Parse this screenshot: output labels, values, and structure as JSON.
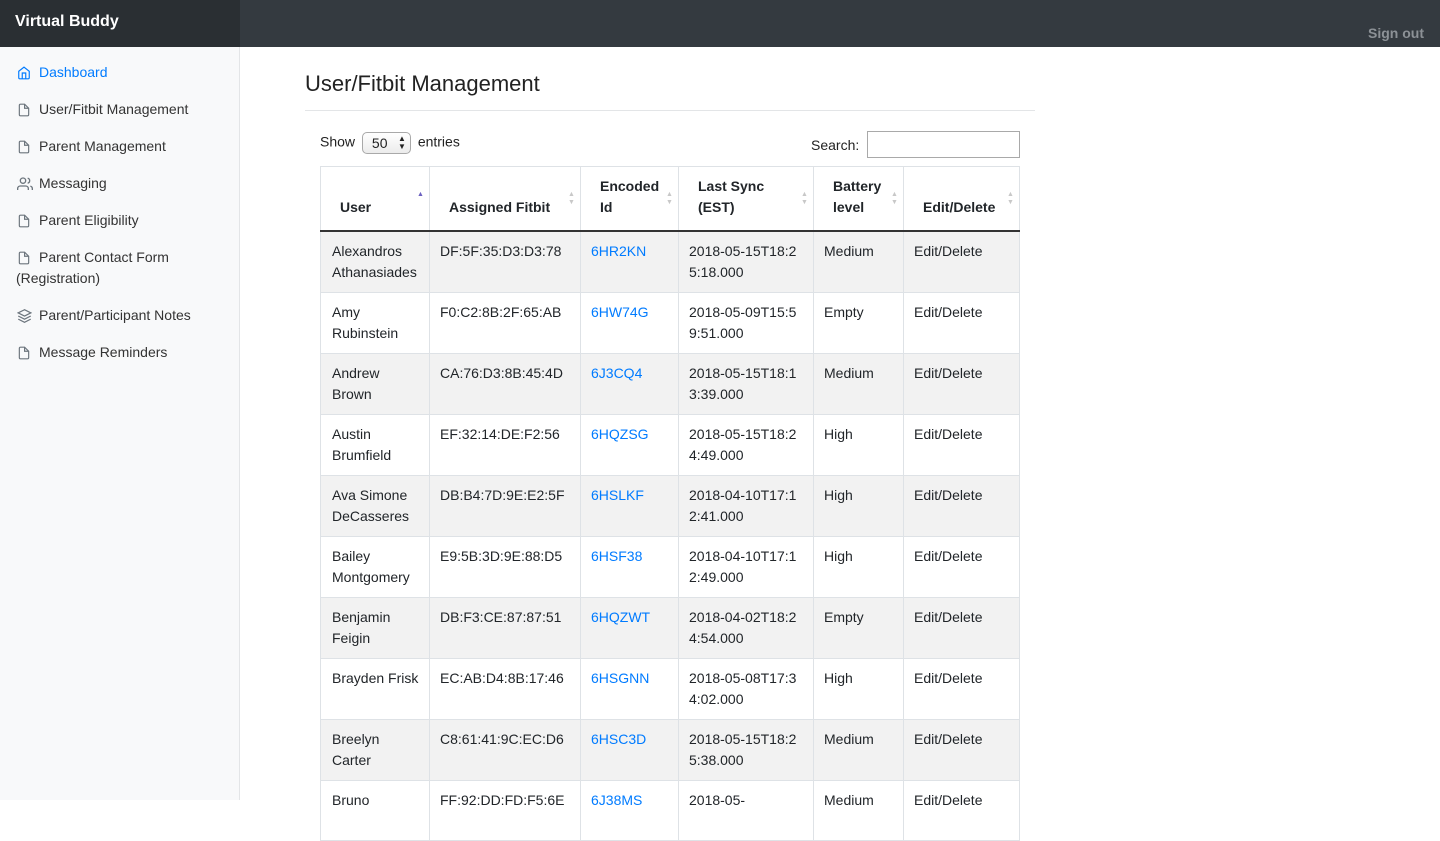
{
  "app": {
    "brand": "Virtual Buddy",
    "signout_label": "Sign out"
  },
  "sidebar": {
    "items": [
      {
        "label": "Dashboard",
        "icon": "home-icon",
        "active": true
      },
      {
        "label": "User/Fitbit Management",
        "icon": "file-icon"
      },
      {
        "label": "Parent Management",
        "icon": "file-icon"
      },
      {
        "label": "Messaging",
        "icon": "users-icon"
      },
      {
        "label": "Parent Eligibility",
        "icon": "file-icon"
      },
      {
        "label": "Parent Contact Form (Registration)",
        "icon": "file-icon"
      },
      {
        "label": "Parent/Participant Notes",
        "icon": "layers-icon"
      },
      {
        "label": "Message Reminders",
        "icon": "file-icon"
      }
    ]
  },
  "main": {
    "title": "User/Fitbit Management",
    "show_label": "Show",
    "entries_label": "entries",
    "page_size": "50",
    "search_label": "Search:",
    "search_value": ""
  },
  "table": {
    "columns": [
      "User",
      "Assigned Fitbit",
      "Encoded Id",
      "Last Sync (EST)",
      "Battery level",
      "Edit/Delete"
    ],
    "sorted_column": "User",
    "rows": [
      {
        "user": "Alexandros Athanasiades",
        "fitbit": "DF:5F:35:D3:D3:78",
        "encoded_id": "6HR2KN",
        "last_sync": "2018-05-15T18:25:18.000",
        "battery": "Medium",
        "action": "Edit/Delete"
      },
      {
        "user": "Amy Rubinstein",
        "fitbit": "F0:C2:8B:2F:65:AB",
        "encoded_id": "6HW74G",
        "last_sync": "2018-05-09T15:59:51.000",
        "battery": "Empty",
        "action": "Edit/Delete"
      },
      {
        "user": "Andrew Brown",
        "fitbit": "CA:76:D3:8B:45:4D",
        "encoded_id": "6J3CQ4",
        "last_sync": "2018-05-15T18:13:39.000",
        "battery": "Medium",
        "action": "Edit/Delete"
      },
      {
        "user": "Austin Brumfield",
        "fitbit": "EF:32:14:DE:F2:56",
        "encoded_id": "6HQZSG",
        "last_sync": "2018-05-15T18:24:49.000",
        "battery": "High",
        "action": "Edit/Delete"
      },
      {
        "user": "Ava Simone DeCasseres",
        "fitbit": "DB:B4:7D:9E:E2:5F",
        "encoded_id": "6HSLKF",
        "last_sync": "2018-04-10T17:12:41.000",
        "battery": "High",
        "action": "Edit/Delete"
      },
      {
        "user": "Bailey Montgomery",
        "fitbit": "E9:5B:3D:9E:88:D5",
        "encoded_id": "6HSF38",
        "last_sync": "2018-04-10T17:12:49.000",
        "battery": "High",
        "action": "Edit/Delete"
      },
      {
        "user": "Benjamin Feigin",
        "fitbit": "DB:F3:CE:87:87:51",
        "encoded_id": "6HQZWT",
        "last_sync": "2018-04-02T18:24:54.000",
        "battery": "Empty",
        "action": "Edit/Delete"
      },
      {
        "user": "Brayden Frisk",
        "fitbit": "EC:AB:D4:8B:17:46",
        "encoded_id": "6HSGNN",
        "last_sync": "2018-05-08T17:34:02.000",
        "battery": "High",
        "action": "Edit/Delete"
      },
      {
        "user": "Breelyn Carter",
        "fitbit": "C8:61:41:9C:EC:D6",
        "encoded_id": "6HSC3D",
        "last_sync": "2018-05-15T18:25:38.000",
        "battery": "Medium",
        "action": "Edit/Delete"
      },
      {
        "user": "Bruno",
        "fitbit": "FF:92:DD:FD:F5:6E",
        "encoded_id": "6J38MS",
        "last_sync": "2018-05-",
        "battery": "Medium",
        "action": "Edit/Delete"
      }
    ]
  }
}
